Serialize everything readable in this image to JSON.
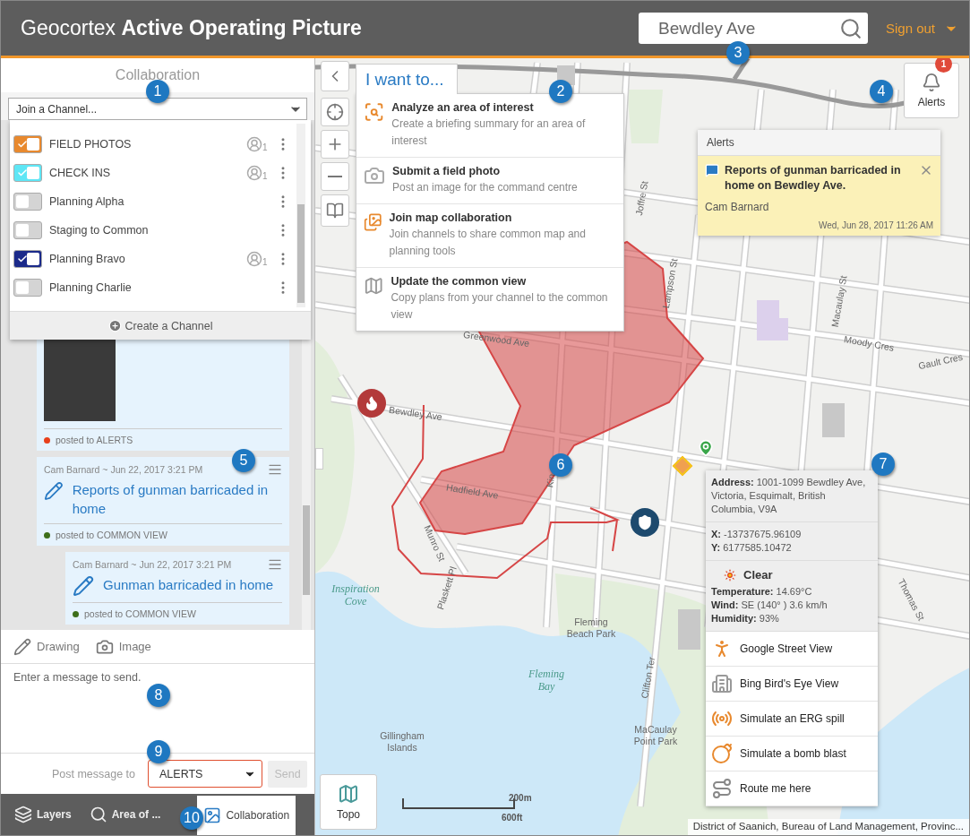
{
  "header": {
    "title": "Geocortex **Active Operating Picture**",
    "search": {
      "value": "Bewdley Ave"
    },
    "sign_out": "Sign out"
  },
  "collaboration": {
    "title": "Collaboration",
    "channel_select": {
      "placeholder": "Join a Channel..."
    },
    "channels": [
      {
        "name": "FIELD PHOTOS",
        "checked": true,
        "color": "#e8892e",
        "members": "1"
      },
      {
        "name": "CHECK INS",
        "checked": true,
        "color": "#5ee6f5",
        "members": "1"
      },
      {
        "name": "Planning Alpha",
        "checked": false
      },
      {
        "name": "Staging to Common",
        "checked": false
      },
      {
        "name": "Planning Bravo",
        "checked": true,
        "color": "#1b2a8a",
        "members": "1"
      },
      {
        "name": "Planning Charlie",
        "checked": false
      }
    ],
    "create_button": "Create a Channel",
    "messages": [
      {
        "kind": "photo",
        "channel": "posted to ALERTS",
        "color": "#e8401c"
      },
      {
        "kind": "drawing",
        "meta": "Cam Barnard ~ Jun 22, 2017 3:21 PM",
        "title": "Reports of gunman barricaded in home",
        "channel": "posted to COMMON VIEW",
        "color": "#3d6e1a",
        "children": [
          {
            "kind": "drawing",
            "meta": "Cam Barnard ~ Jun 22, 2017 3:21 PM",
            "title": "Gunman barricaded in home",
            "channel": "posted to COMMON VIEW",
            "color": "#3d6e1a"
          }
        ]
      }
    ]
  },
  "composer": {
    "tools": [
      {
        "kind": "drawing",
        "label": "Drawing"
      },
      {
        "kind": "image",
        "label": "Image"
      }
    ],
    "message": {
      "placeholder": "Enter a message to send."
    },
    "post_label": "Post message to",
    "post_target": "ALERTS",
    "send": {
      "label": "Send",
      "disabled": true
    }
  },
  "bottom_tabs": [
    {
      "kind": "layers",
      "label": "Layers",
      "selected": false
    },
    {
      "kind": "area",
      "label": "Area of ...",
      "selected": false
    },
    {
      "kind": "collaboration",
      "label": "Collaboration",
      "selected": true
    }
  ],
  "map": {
    "i_want_to": {
      "label": "I want to...",
      "items": [
        {
          "kind": "analyze",
          "title": "Analyze an area of interest",
          "description": "Create a briefing summary for an area of interest"
        },
        {
          "kind": "photo",
          "title": "Submit a field photo",
          "description": "Post an image for the command centre"
        },
        {
          "kind": "collaborate",
          "title": "Join map collaboration",
          "description": "Join channels to share common map and planning tools"
        },
        {
          "kind": "update",
          "title": "Update the common view",
          "description": "Copy plans from your channel to the common view"
        }
      ]
    },
    "alerts": {
      "label": "Alerts",
      "badge": "1",
      "panel": {
        "title": "Alerts",
        "items": [
          {
            "title": "Reports of gunman barricaded in home on Bewdley Ave.",
            "author": "Cam Barnard",
            "time": "Wed, Jun 28, 2017 11:26 AM"
          }
        ]
      }
    },
    "identify": {
      "address": "**Address:** 1001-1099 Bewdley Ave, Victoria, Esquimalt, British Columbia, V9A",
      "coords": [
        "**X:** -13737675.96109",
        "**Y:** 6177585.10472"
      ],
      "weather": {
        "condition": "Clear",
        "lines": [
          "**Temperature:** 14.69°C",
          "**Wind:** SE (140° ) 3.6 km/h",
          "**Humidity:** 93%"
        ]
      },
      "actions": [
        {
          "kind": "street",
          "label": "Google Street View"
        },
        {
          "kind": "birdseye",
          "label": "Bing Bird's Eye View"
        },
        {
          "kind": "spill",
          "label": "Simulate an ERG spill"
        },
        {
          "kind": "bomb",
          "label": "Simulate a bomb blast"
        },
        {
          "kind": "route",
          "label": "Route me here"
        }
      ]
    },
    "labels": [
      {
        "kind": "street",
        "text": "Greenwood Ave"
      },
      {
        "kind": "street",
        "text": "Bewdley Ave"
      },
      {
        "kind": "street",
        "text": "Hadfield Ave"
      },
      {
        "kind": "street",
        "text": "Munro St"
      },
      {
        "kind": "street",
        "text": "Plaskett Pl"
      },
      {
        "kind": "street",
        "text": "Kin"
      },
      {
        "kind": "street",
        "text": "Joffre St"
      },
      {
        "kind": "street",
        "text": "Lampson St"
      },
      {
        "kind": "street",
        "text": "Macaulay St"
      },
      {
        "kind": "street",
        "text": "Moody Cres"
      },
      {
        "kind": "street",
        "text": "Gault Cres"
      },
      {
        "kind": "street",
        "text": "Clifton Ter"
      },
      {
        "kind": "street",
        "text": "Thomas St"
      },
      {
        "kind": "water",
        "text": "Inspiration Cove"
      },
      {
        "kind": "water",
        "text": "Fleming Bay"
      },
      {
        "kind": "place",
        "text": "Gillingham Islands"
      },
      {
        "kind": "place",
        "text": "Fleming Beach Park"
      },
      {
        "kind": "place",
        "text": "MaCaulay Point Park"
      }
    ],
    "basemap": {
      "label": "Topo"
    },
    "scale": {
      "metric": "200m",
      "imperial": "600ft"
    },
    "attribution": "District of Saanich, Bureau of Land Management, Provinc..."
  },
  "callouts": [
    "1",
    "2",
    "3",
    "4",
    "5",
    "6",
    "7",
    "8",
    "9",
    "10"
  ]
}
